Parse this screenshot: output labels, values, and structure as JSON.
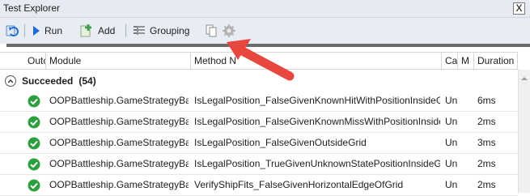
{
  "window": {
    "title": "Test Explorer",
    "close_glyph": "X"
  },
  "toolbar": {
    "items": [
      {
        "id": "refresh",
        "icon": "refresh-icon",
        "label": ""
      },
      {
        "id": "run",
        "icon": "run-icon",
        "label": "Run"
      },
      {
        "id": "add",
        "icon": "add-icon",
        "label": "Add"
      },
      {
        "id": "grouping",
        "icon": "grouping-icon",
        "label": "Grouping"
      },
      {
        "id": "copy",
        "icon": "copy-icon",
        "label": ""
      },
      {
        "id": "settings",
        "icon": "gear-icon",
        "label": ""
      }
    ]
  },
  "grid": {
    "columns": [
      "Outc",
      "Module",
      "Method N",
      "Ca",
      "M",
      "Duration"
    ],
    "group": {
      "label": "Succeeded",
      "count": "(54)",
      "toggle_glyph": "^"
    },
    "rows": [
      {
        "module": "OOPBattleship.GameStrategyBase`",
        "method": "IsLegalPosition_FalseGivenKnownHitWithPositionInsideGrid",
        "ca": "Un",
        "duration": "6ms"
      },
      {
        "module": "OOPBattleship.GameStrategyBase`",
        "method": "IsLegalPosition_FalseGivenKnownMissWithPositionInsideGrid",
        "ca": "Un",
        "duration": "2ms"
      },
      {
        "module": "OOPBattleship.GameStrategyBase`",
        "method": "IsLegalPosition_FalseGivenOutsideGrid",
        "ca": "Un",
        "duration": "3ms"
      },
      {
        "module": "OOPBattleship.GameStrategyBase`",
        "method": "IsLegalPosition_TrueGivenUnknownStatePositionInsideGrid",
        "ca": "Un",
        "duration": "2ms"
      },
      {
        "module": "OOPBattleship.GameStrategyBase`",
        "method": "VerifyShipFits_FalseGivenHorizontalEdgeOfGrid",
        "ca": "Un",
        "duration": "2ms"
      }
    ]
  },
  "colors": {
    "pass_green": "#2e9f3e",
    "arrow_red": "#e8473f",
    "toolbar_bg": "#e8edf4"
  }
}
